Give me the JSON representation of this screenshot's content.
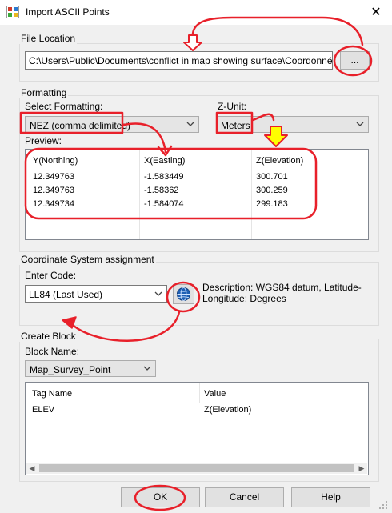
{
  "window": {
    "title": "Import ASCII Points",
    "close_glyph": "✕"
  },
  "file_location": {
    "group_label": "File Location",
    "path": "C:\\Users\\Public\\Documents\\conflict in map showing surface\\Coordonnées XYZ",
    "browse_label": "..."
  },
  "formatting": {
    "group_label": "Formatting",
    "select_label": "Select Formatting:",
    "select_value": "NEZ (comma delimited)",
    "zunit_label": "Z-Unit:",
    "zunit_value": "Meters",
    "preview_label": "Preview:",
    "columns": [
      "Y(Northing)",
      "X(Easting)",
      "Z(Elevation)"
    ],
    "rows": [
      [
        "12.349763",
        "-1.583449",
        "300.701"
      ],
      [
        "12.349763",
        "-1.58362",
        "300.259"
      ],
      [
        "12.349734",
        "-1.584074",
        "299.183"
      ]
    ]
  },
  "coordinate_system": {
    "group_label": "Coordinate System assignment",
    "enter_code_label": "Enter Code:",
    "code_value": "LL84 (Last Used)",
    "description": "Description: WGS84 datum, Latitude-Longitude; Degrees"
  },
  "create_block": {
    "group_label": "Create Block",
    "block_name_label": "Block Name:",
    "block_name_value": "Map_Survey_Point",
    "columns": [
      "Tag Name",
      "Value"
    ],
    "rows": [
      [
        "ELEV",
        "Z(Elevation)"
      ]
    ]
  },
  "buttons": {
    "ok": "OK",
    "cancel": "Cancel",
    "help": "Help"
  },
  "colors": {
    "annotation_red": "#e8202a",
    "annotation_yellow": "#ffff00",
    "globe_blue": "#1e5fb4"
  },
  "icons": [
    "app-icon",
    "close-icon",
    "chevron-down-icon",
    "globe-icon"
  ]
}
